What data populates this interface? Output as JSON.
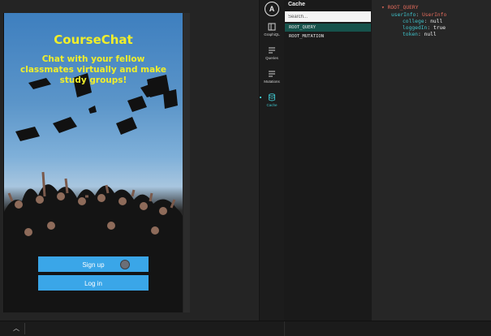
{
  "app": {
    "title": "CourseChat",
    "tagline": "Chat with your fellow classmates virtually and make study groups!",
    "signup_label": "Sign up",
    "login_label": "Log in"
  },
  "devtools": {
    "logo_letter": "A",
    "nav": [
      {
        "label": "GraphiQL",
        "icon": "window-icon"
      },
      {
        "label": "Queries",
        "icon": "list-icon"
      },
      {
        "label": "Mutations",
        "icon": "list-icon"
      },
      {
        "label": "Cache",
        "icon": "database-icon"
      }
    ],
    "active_nav": "Cache"
  },
  "cache": {
    "title": "Cache",
    "search_placeholder": "Search...",
    "entries": [
      "ROOT_QUERY",
      "ROOT_MUTATION"
    ],
    "selected": "ROOT_QUERY"
  },
  "detail": {
    "root": "ROOT_QUERY",
    "object_key": "userInfo",
    "object_type": "UserInfo",
    "fields": [
      {
        "key": "college",
        "value": "null"
      },
      {
        "key": "loggedIn",
        "value": "true"
      },
      {
        "key": "token",
        "value": "null"
      }
    ]
  },
  "colors": {
    "accent": "#3fc1c9",
    "title_yellow": "#f0ee2a",
    "button_blue": "#3aa6e8",
    "selected_row": "#16524b"
  }
}
